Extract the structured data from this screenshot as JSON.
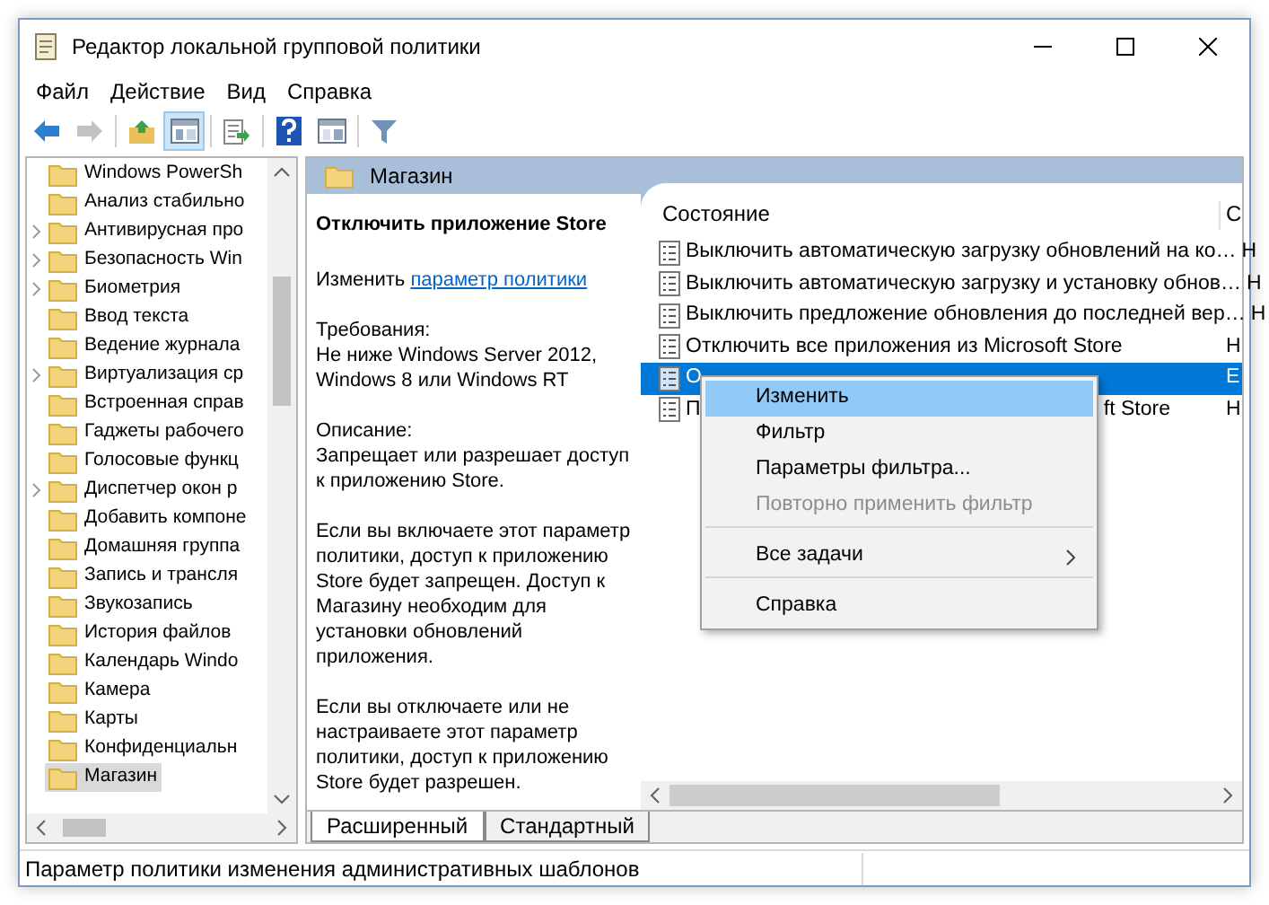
{
  "window": {
    "title": "Редактор локальной групповой политики"
  },
  "menu": [
    "Файл",
    "Действие",
    "Вид",
    "Справка"
  ],
  "toolbar": [
    {
      "kind": "back",
      "disabled": false,
      "pressed": false
    },
    {
      "kind": "forward",
      "disabled": true,
      "pressed": false
    },
    {
      "kind": "up",
      "disabled": false,
      "pressed": false
    },
    {
      "kind": "tree",
      "disabled": false,
      "pressed": true
    },
    {
      "kind": "export",
      "disabled": false,
      "pressed": false
    },
    {
      "kind": "help",
      "disabled": false,
      "pressed": false
    },
    {
      "kind": "pane",
      "disabled": false,
      "pressed": false
    },
    {
      "kind": "filter",
      "disabled": false,
      "pressed": false
    }
  ],
  "tree": [
    {
      "label": "Windows PowerSh",
      "expandable": false,
      "selected": false
    },
    {
      "label": "Анализ стабильно",
      "expandable": false,
      "selected": false
    },
    {
      "label": "Антивирусная про",
      "expandable": true,
      "selected": false
    },
    {
      "label": "Безопасность Win",
      "expandable": true,
      "selected": false
    },
    {
      "label": "Биометрия",
      "expandable": true,
      "selected": false
    },
    {
      "label": "Ввод текста",
      "expandable": false,
      "selected": false
    },
    {
      "label": "Ведение журнала",
      "expandable": false,
      "selected": false
    },
    {
      "label": "Виртуализация ср",
      "expandable": true,
      "selected": false
    },
    {
      "label": "Встроенная справ",
      "expandable": false,
      "selected": false
    },
    {
      "label": "Гаджеты рабочего",
      "expandable": false,
      "selected": false
    },
    {
      "label": "Голосовые функц",
      "expandable": false,
      "selected": false
    },
    {
      "label": "Диспетчер окон р",
      "expandable": true,
      "selected": false
    },
    {
      "label": "Добавить компоне",
      "expandable": false,
      "selected": false
    },
    {
      "label": "Домашняя группа",
      "expandable": false,
      "selected": false
    },
    {
      "label": "Запись и трансля",
      "expandable": false,
      "selected": false
    },
    {
      "label": "Звукозапись",
      "expandable": false,
      "selected": false
    },
    {
      "label": "История файлов",
      "expandable": false,
      "selected": false
    },
    {
      "label": "Календарь Windo",
      "expandable": false,
      "selected": false
    },
    {
      "label": "Камера",
      "expandable": false,
      "selected": false
    },
    {
      "label": "Карты",
      "expandable": false,
      "selected": false
    },
    {
      "label": "Конфиденциальн",
      "expandable": false,
      "selected": false
    },
    {
      "label": "Магазин",
      "expandable": false,
      "selected": true
    }
  ],
  "panel": {
    "title": "Магазин",
    "description": {
      "heading": "Отключить приложение Store",
      "edit_prefix": "Изменить",
      "edit_link": "параметр политики",
      "requirements_label": "Требования:",
      "requirements": "Не ниже Windows Server 2012, Windows 8 или Windows RT",
      "description_label": "Описание:",
      "paragraphs": [
        "Запрещает или разрешает доступ к приложению Store.",
        "Если вы включаете этот параметр политики, доступ к приложению Store будет запрещен. Доступ к Магазину необходим для установки обновлений приложения.",
        "Если вы отключаете или не настраиваете этот параметр политики, доступ к приложению Store будет разрешен."
      ]
    },
    "columns": [
      "Состояние",
      "С"
    ],
    "rows": [
      {
        "name": "Выключить автоматическую загрузку обновлений на ко…",
        "tail": "",
        "state": "Н",
        "selected": false
      },
      {
        "name": "Выключить автоматическую загрузку и установку обнов…",
        "tail": "",
        "state": "Н",
        "selected": false
      },
      {
        "name": "Выключить предложение обновления до последней вер…",
        "tail": "",
        "state": "Н",
        "selected": false
      },
      {
        "name": "Отключить все приложения из Microsoft Store",
        "tail": "",
        "state": "Н",
        "selected": false
      },
      {
        "name": "О",
        "tail": "",
        "state": "Е",
        "selected": true
      },
      {
        "name": "П",
        "tail": "ft Store",
        "state": "Н",
        "selected": false
      }
    ],
    "tabs": [
      {
        "label": "Расширенный",
        "selected": true
      },
      {
        "label": "Стандартный",
        "selected": false
      }
    ]
  },
  "context_menu": [
    {
      "label": "Изменить",
      "selected": true,
      "disabled": false,
      "submenu": false,
      "separator_before": false
    },
    {
      "label": "Фильтр",
      "selected": false,
      "disabled": false,
      "submenu": false,
      "separator_before": false
    },
    {
      "label": "Параметры фильтра...",
      "selected": false,
      "disabled": false,
      "submenu": false,
      "separator_before": false
    },
    {
      "label": "Повторно применить фильтр",
      "selected": false,
      "disabled": true,
      "submenu": false,
      "separator_before": false
    },
    {
      "label": "Все задачи",
      "selected": false,
      "disabled": false,
      "submenu": true,
      "separator_before": true
    },
    {
      "label": "Справка",
      "selected": false,
      "disabled": false,
      "submenu": false,
      "separator_before": true
    }
  ],
  "status_bar": "Параметр политики изменения административных шаблонов"
}
